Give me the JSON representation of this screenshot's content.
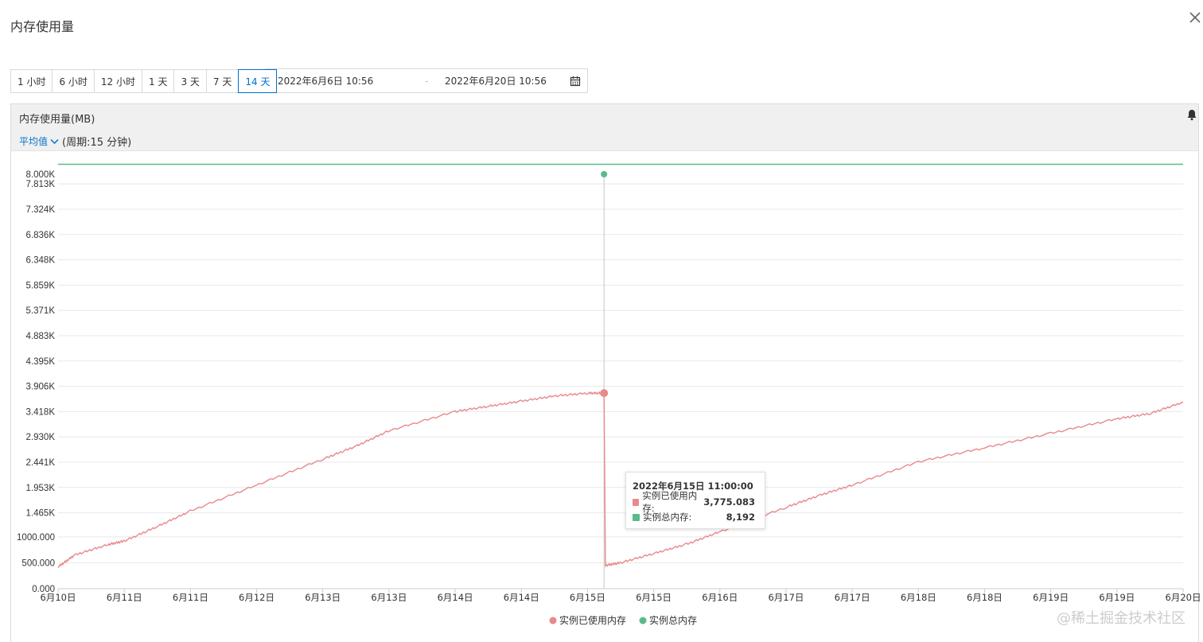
{
  "dialog": {
    "title": "内存使用量",
    "close_icon": "close-icon"
  },
  "time_range": {
    "buttons": [
      "1 小时",
      "6 小时",
      "12 小时",
      "1 天",
      "3 天",
      "7 天",
      "14 天"
    ],
    "active": "14 天",
    "start": "2022年6月6日 10:56",
    "separator": "-",
    "end": "2022年6月20日 10:56",
    "calendar_icon": "calendar-icon"
  },
  "panel": {
    "title": "内存使用量(MB)",
    "aggregation": "平均值",
    "period": "(周期:15 分钟)",
    "bell_icon": "bell-icon"
  },
  "tooltip": {
    "time": "2022年6月15日 11:00:00",
    "rows": [
      {
        "label": "实例已使用内存:",
        "value": "3,775.083"
      },
      {
        "label": "实例总内存:",
        "value": "8,192"
      }
    ]
  },
  "watermark": "@稀土掘金技术社区",
  "colors": {
    "used": "#e8898b",
    "total": "#5cba8a",
    "accent": "#0070cc"
  },
  "chart_data": {
    "type": "line",
    "y_tick_labels": [
      "0.000",
      "500.000",
      "1000.000",
      "1.465K",
      "1.953K",
      "2.441K",
      "2.930K",
      "3.418K",
      "3.906K",
      "4.395K",
      "4.883K",
      "5.371K",
      "5.859K",
      "6.348K",
      "6.836K",
      "7.324K",
      "7.813K",
      "8.000K"
    ],
    "y_tick_values": [
      0,
      500,
      1000,
      1465,
      1953,
      2441,
      2930,
      3418,
      3906,
      4395,
      4883,
      5371,
      5859,
      6348,
      6836,
      7324,
      7813,
      8000
    ],
    "ylim": [
      0,
      8192
    ],
    "x_tick_labels": [
      "6月10日",
      "6月11日",
      "6月11日",
      "6月12日",
      "6月13日",
      "6月13日",
      "6月14日",
      "6月14日",
      "6月15日",
      "6月15日",
      "6月16日",
      "6月17日",
      "6月17日",
      "6月18日",
      "6月18日",
      "6月19日",
      "6月19日",
      "6月20日"
    ],
    "grid": true,
    "legend_position": "bottom",
    "series": [
      {
        "name": "实例已使用内存",
        "x": [
          0,
          0.25,
          0.75,
          1,
          1.5,
          2,
          3,
          4,
          4.5,
          5,
          6,
          6.5,
          7,
          7.5,
          8,
          8.25,
          8.27,
          8.5,
          9,
          9.5,
          10,
          11,
          11.5,
          12,
          13,
          14,
          15,
          16,
          16.5,
          17
        ],
        "values": [
          420,
          650,
          850,
          920,
          1200,
          1500,
          2000,
          2500,
          2750,
          3050,
          3420,
          3520,
          3620,
          3720,
          3775,
          3775,
          450,
          500,
          680,
          860,
          1100,
          1570,
          1800,
          2000,
          2450,
          2720,
          3000,
          3280,
          3380,
          3600
        ]
      },
      {
        "name": "实例总内存",
        "x": [
          0,
          17
        ],
        "values": [
          8192,
          8192
        ]
      }
    ],
    "highlight": {
      "x": 8.25,
      "used": 3775.083,
      "total": 8192
    }
  }
}
